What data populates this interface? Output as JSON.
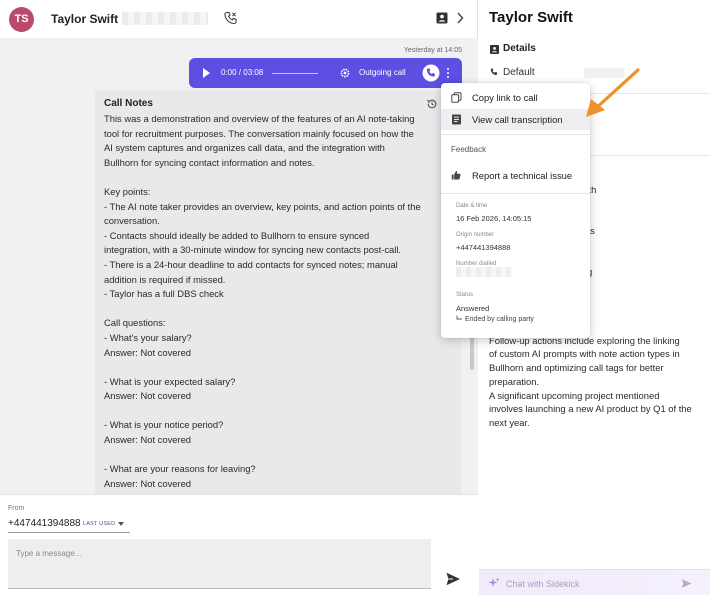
{
  "header": {
    "avatar_initials": "TS",
    "contact_name": "Taylor Swift",
    "icons": [
      "phone-call-icon",
      "contact-card-icon",
      "chevron-right-icon"
    ]
  },
  "chat": {
    "timestamp": "Yesterday at 14:05",
    "call": {
      "progress": "0:00 / 03:08",
      "direction": "Outgoing call",
      "accent": "#5c4fe2"
    },
    "note": {
      "title": "Call Notes",
      "lines": [
        "This was a demonstration and overview of the features of an AI note-taking",
        "tool for recruitment purposes. The conversation mainly focused on how the",
        "AI system captures and organizes call data, and the integration with",
        "Bullhorn for syncing contact information and notes.",
        "",
        "Key points:",
        "- The AI note taker provides an overview, key points, and action points of the",
        "conversation.",
        "- Contacts should ideally be added to Bullhorn to ensure synced",
        "integration, with a 30-minute window for syncing new contacts post-call.",
        "- There is a 24-hour deadline to add contacts for synced notes; manual",
        "addition is required if missed.",
        "- Taylor has a full DBS check",
        "",
        "Call questions:",
        "- What's your salary?",
        "Answer: Not covered",
        "",
        "- What is your expected salary?",
        "Answer: Not covered",
        "",
        "- What is your notice period?",
        "Answer: Not covered",
        "",
        "- What are your reasons for leaving?",
        "Answer: Not covered"
      ]
    }
  },
  "composer": {
    "from_label": "From",
    "from_number": "+447441394888",
    "last_used": "LAST USED",
    "placeholder": "Type a message..."
  },
  "menu": {
    "items": [
      {
        "label": "Copy link to call",
        "icon": "copy-icon"
      },
      {
        "label": "View call transcription",
        "icon": "transcript-icon"
      }
    ],
    "feedback_heading": "Feedback",
    "report_label": "Report a technical issue",
    "details": {
      "datetime_label": "Date & time",
      "datetime": "16 Feb 2026, 14:05:15",
      "origin_label": "Origin number",
      "origin": "+447441394888",
      "dialled_label": "Number dialled",
      "status_label": "Status",
      "status": "Answered",
      "ended": "Ended by calling party"
    }
  },
  "right": {
    "title": "Taylor Swift",
    "details_label": "Details",
    "phone_label": "Default",
    "summary_lines": [
      "technical discussions with",
      "tegration of an AI note-",
      "ephony for recruitment",
      "g the automation of notes",
      "",
      "",
      "ussed about customizing",
      "g AI features for",
      "n the need to ensure",
      "ith Bullhorn within 24",
      "",
      "Follow-up actions include exploring the linking",
      "of custom AI prompts with note action types in",
      "Bullhorn and optimizing call tags for better",
      "preparation.",
      "A significant upcoming project mentioned",
      "involves launching a new AI product by Q1 of the",
      "next year."
    ],
    "sidekick_placeholder": "Chat with Sidekick"
  },
  "annotation_color": "#f0902a"
}
